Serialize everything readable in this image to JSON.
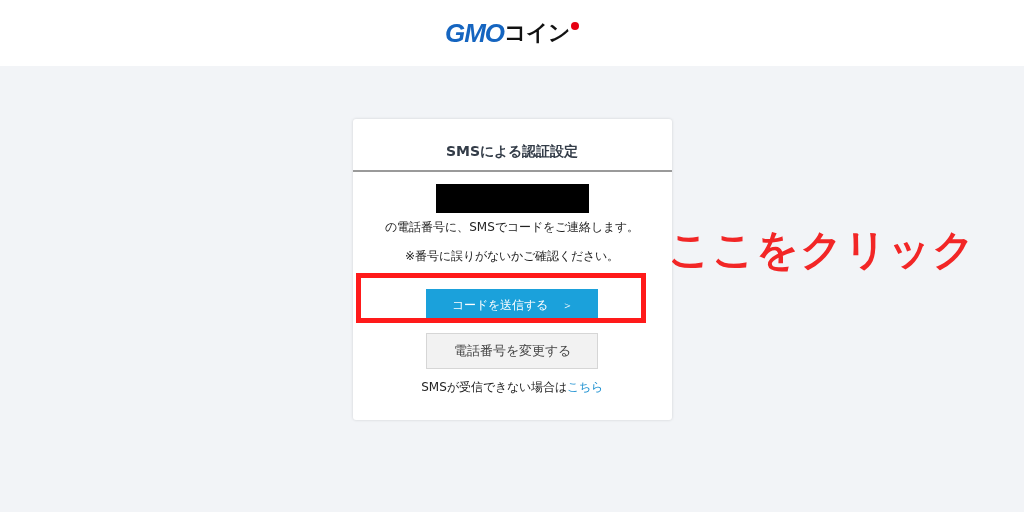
{
  "header": {
    "logo": {
      "primary": "GMO",
      "secondary": "コイン"
    }
  },
  "card": {
    "title": "SMSによる認証設定",
    "message": "の電話番号に、SMSでコードをご連絡します。",
    "note": "※番号に誤りがないかご確認ください。",
    "buttons": [
      {
        "label": "コードを送信する",
        "kind": "primary",
        "arrow": "＞"
      },
      {
        "label": "電話番号を変更する",
        "kind": "secondary"
      }
    ],
    "footer_text": "SMSが受信できない場合は",
    "footer_link": "こちら"
  },
  "annotation": {
    "text": "ここをクリック"
  }
}
